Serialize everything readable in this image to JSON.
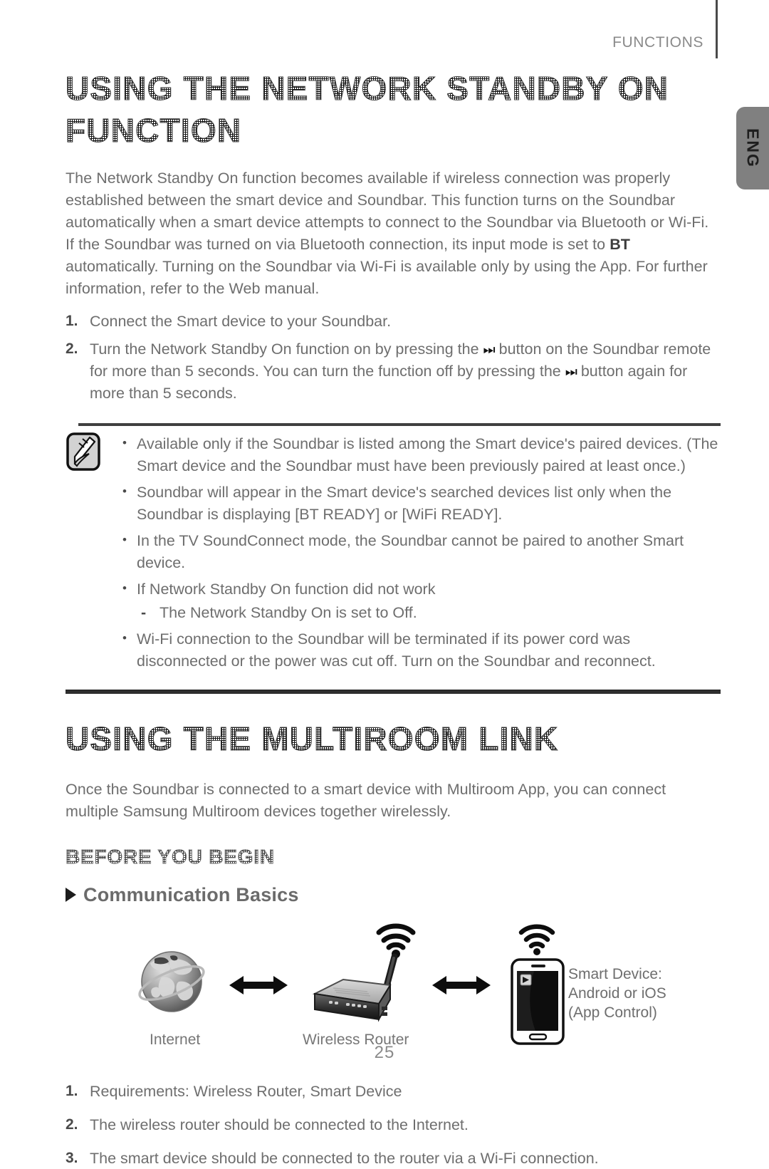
{
  "header": {
    "section_label": "FUNCTIONS",
    "language_tab": "ENG"
  },
  "sections": [
    {
      "title": "USING THE NETWORK STANDBY ON FUNCTION",
      "intro": "The Network Standby On function becomes available if wireless connection was properly established between the smart device and Soundbar. This function turns on the Soundbar automatically when a smart device attempts to connect to the Soundbar via Bluetooth or Wi-Fi. If the Soundbar was turned on via Bluetooth connection, its input mode is set to ",
      "intro_bold": "BT",
      "intro_tail": " automatically. Turning on the Soundbar via Wi-Fi is available only by using the App. For further information, refer to the Web manual.",
      "steps": [
        {
          "num": "1.",
          "text": "Connect the Smart device to your Soundbar."
        },
        {
          "num": "2.",
          "text_part1": "Turn the Network Standby On function on by pressing the ",
          "glyph": "⏭",
          "text_part2": " button on the Soundbar remote for more than 5 seconds. You can turn the function off by pressing the ",
          "glyph2": "⏭",
          "text_part3": " button again for more than 5 seconds."
        }
      ]
    }
  ],
  "note": {
    "icon_name": "note-pencil-icon",
    "bullets": [
      "Available only if the Soundbar is listed among the Smart device's paired devices. (The Smart device and the Soundbar must have been previously paired at least once.)",
      "Soundbar will appear in the Smart device's searched devices list only when the Soundbar is displaying [BT READY] or [WiFi READY].",
      "In the TV SoundConnect mode, the Soundbar cannot be paired to another Smart device.",
      "If Network Standby On function did not work",
      "Wi-Fi connection to the Soundbar will be terminated if its power cord was disconnected or the power was cut off. Turn on the Soundbar and reconnect."
    ],
    "sub_dash_mark": "-",
    "sub_dash_text": "The Network Standby On is set to Off.",
    "bullet_mark": "•"
  },
  "multiroom": {
    "title": "USING THE MULTIROOM LINK",
    "intro": "Once the Soundbar is connected to a smart device with Multiroom App, you can connect multiple Samsung Multiroom devices together wirelessly.",
    "subtitle": "BEFORE YOU BEGIN",
    "subsubtitle": "Communication Basics",
    "diagram": {
      "internet_label": "Internet",
      "router_label": "Wireless Router",
      "smart_device_line1": "Smart Device:",
      "smart_device_line2": "Android or iOS",
      "smart_device_line3": "(App Control)"
    },
    "steps": [
      {
        "num": "1.",
        "text": "Requirements: Wireless Router, Smart Device"
      },
      {
        "num": "2.",
        "text": "The wireless router should be connected to the Internet."
      },
      {
        "num": "3.",
        "text": "The smart device should be connected to the router via a Wi-Fi connection."
      }
    ]
  },
  "footer": {
    "page_number": "25"
  },
  "colors": {
    "body_text": "#6e6e6e",
    "heading": "#3a3a3a",
    "rule": "#2e2e2e",
    "tab_bg": "#808080",
    "accent_dark": "#1c1c1c"
  }
}
